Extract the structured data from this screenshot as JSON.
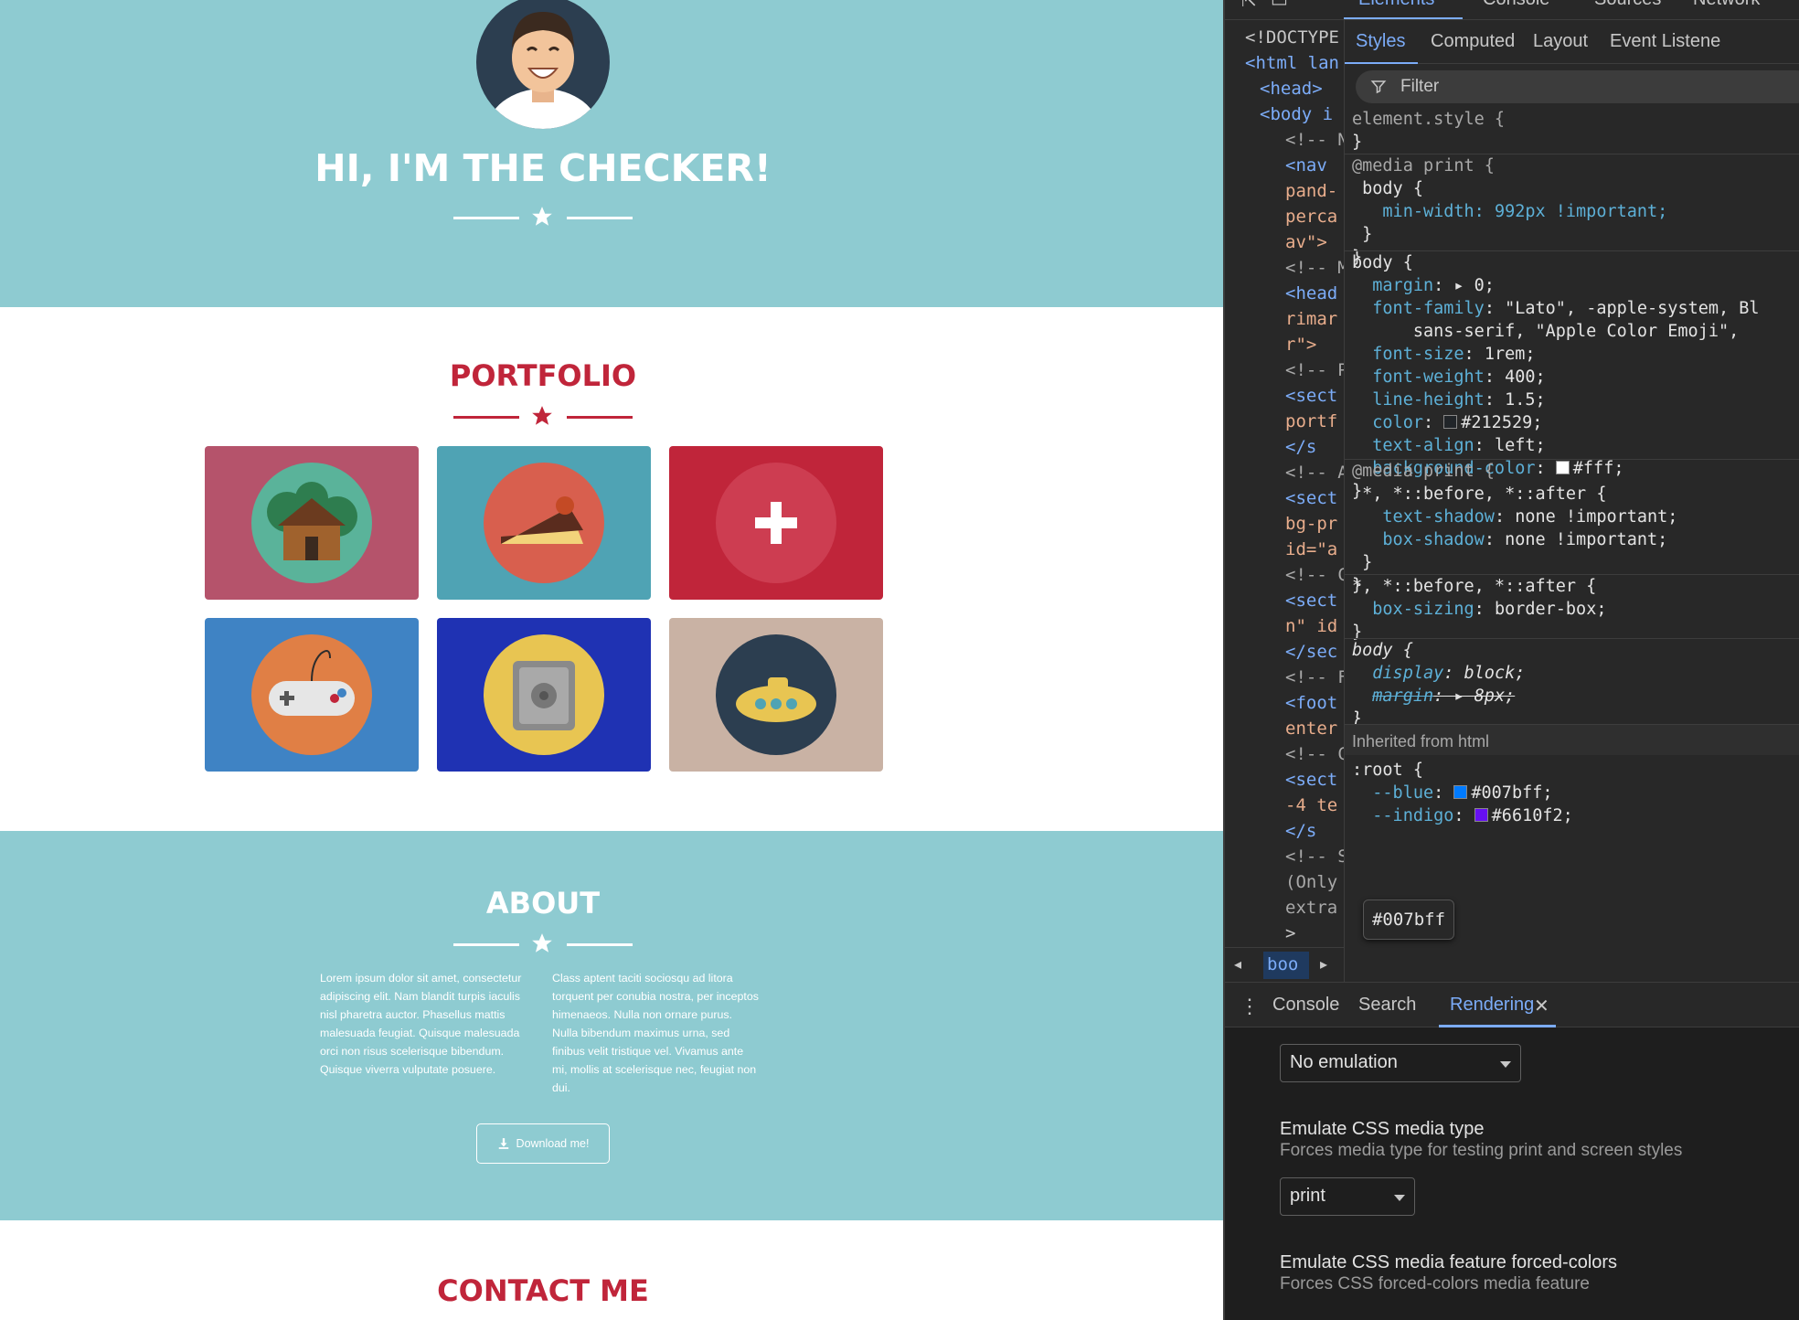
{
  "site": {
    "hero_title": "HI, I'M THE CHECKER!",
    "portfolio_title": "PORTFOLIO",
    "portfolio_items": [
      {
        "name": "cabin",
        "bg": "#b5536b"
      },
      {
        "name": "cake",
        "bg": "#4fa3b4"
      },
      {
        "name": "circus-tent",
        "bg": "#c0253a"
      },
      {
        "name": "game-controller",
        "bg": "#3f83c4"
      },
      {
        "name": "safe",
        "bg": "#1f32b3"
      },
      {
        "name": "submarine",
        "bg": "#c9b2a4"
      }
    ],
    "about_title": "ABOUT",
    "about_col1": "Lorem ipsum dolor sit amet, consectetur adipiscing elit. Nam blandit turpis iaculis nisl pharetra auctor. Phasellus mattis malesuada feugiat. Quisque malesuada orci non risus scelerisque bibendum. Quisque viverra vulputate posuere.",
    "about_col2": "Class aptent taciti sociosqu ad litora torquent per conubia nostra, per inceptos himenaeos. Nulla non ornare purus. Nulla bibendum maximus urna, sed finibus velit tristique vel. Vivamus ante mi, mollis at scelerisque nec, feugiat non dui.",
    "download_label": "Download me!",
    "contact_title": "CONTACT ME",
    "colors": {
      "teal": "#8ecbd1",
      "accent": "#c0253a",
      "white": "#ffffff"
    }
  },
  "devtools": {
    "top_tabs": [
      "Elements",
      "Console",
      "Sources",
      "Network"
    ],
    "sub_tabs": [
      "Styles",
      "Computed",
      "Layout",
      "Event Listene"
    ],
    "filter_placeholder": "Filter",
    "dom_lines": [
      "<!DOCTYPE",
      "<html lan",
      "<head>",
      "<body i",
      "<!-- N",
      "<nav",
      "pand-",
      "perca",
      "av\">",
      "<!-- M",
      "<head",
      "rimar",
      "r\">",
      "<!-- P",
      "<sect",
      "portf",
      "</s",
      "<!-- A",
      "<sect",
      "bg-pr",
      "id=\"a",
      "<!-- C",
      "<sect",
      "n\" id",
      "</sec",
      "<!-- F",
      "<foot",
      "enter",
      "<!-- C",
      "<sect",
      "-4 te",
      "</s",
      "<!-- S",
      "(Only",
      "extra",
      ">"
    ],
    "breadcrumb": "boo",
    "styles": {
      "element_style": "element.style {",
      "media_print_1": "@media print {",
      "body_sel": "body {",
      "min_width": "min-width: 992px !important;",
      "font_family_val": "\"Lato\", -apple-system, Bl",
      "font_family_cont": "sans-serif, \"Apple Color Emoji\",",
      "font_size_val": "1rem;",
      "font_weight_val": "400;",
      "line_height_val": "1.5;",
      "color_val": "#212529;",
      "text_align_val": "left;",
      "bg_val": "#fff;",
      "star_sel": "*, *::before, *::after {",
      "text_shadow": "none !important;",
      "box_shadow": "none !important;",
      "box_sizing_val": "border-box;",
      "display_val": "block;",
      "margin_val": "8px;",
      "inherited": "Inherited from html",
      "root": ":root {",
      "blue_val": "#007bff;",
      "indigo_val": "#6610f2;",
      "tooltip": "#007bff"
    },
    "drawer_tabs": [
      "Console",
      "Search",
      "Rendering"
    ],
    "rendering": {
      "first_select": "No emulation",
      "media_type_title": "Emulate CSS media type",
      "media_type_desc": "Forces media type for testing print and screen styles",
      "media_type_value": "print",
      "forced_colors_title": "Emulate CSS media feature forced-colors",
      "forced_colors_desc": "Forces CSS forced-colors media feature"
    }
  }
}
